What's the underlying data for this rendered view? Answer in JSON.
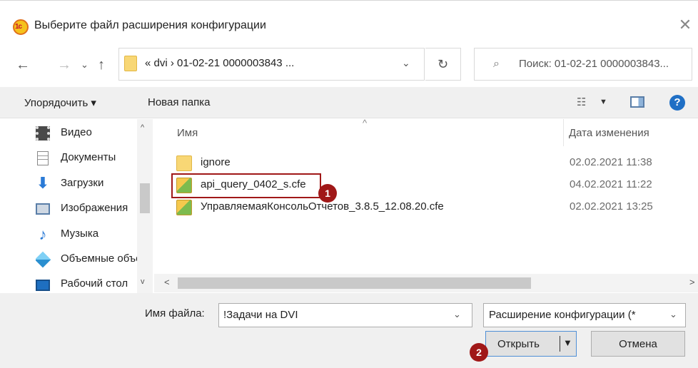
{
  "window": {
    "title": "Выберите файл расширения конфигурации",
    "app_icon_text": "1c",
    "close_glyph": "✕"
  },
  "address_bar": {
    "back_glyph": "←",
    "forward_glyph": "→",
    "recent_glyph": "⌄",
    "up_glyph": "↑",
    "path": "« dvi › 01-02-21 0000003843 ...",
    "dropdown_glyph": "⌄",
    "refresh_glyph": "↻"
  },
  "search": {
    "icon_glyph": "⌕",
    "text": "Поиск: 01-02-21 0000003843..."
  },
  "toolbar": {
    "organize_label": "Упорядочить ▾",
    "new_folder_label": "Новая папка",
    "view_glyph": "☷",
    "view_caret": "▼",
    "help_label": "?"
  },
  "nav_pane": {
    "items": [
      {
        "label": "Видео",
        "icon": "video-icon",
        "color": "#4a4a4a"
      },
      {
        "label": "Документы",
        "icon": "documents-icon",
        "color": "#7a7a7a"
      },
      {
        "label": "Загрузки",
        "icon": "downloads-icon",
        "color": "#2a7ad6"
      },
      {
        "label": "Изображения",
        "icon": "pictures-icon",
        "color": "#5a7ea8"
      },
      {
        "label": "Музыка",
        "icon": "music-icon",
        "color": "#2a7ad6"
      },
      {
        "label": "Объемные объекты",
        "icon": "3d-objects-icon",
        "color": "#3aa0e0"
      },
      {
        "label": "Рабочий стол",
        "icon": "desktop-icon",
        "color": "#1e6fc0"
      }
    ],
    "scroll_up": "^",
    "scroll_down": "v"
  },
  "file_list": {
    "sort_glyph": "^",
    "columns": {
      "name": "Имя",
      "date": "Дата изменения"
    },
    "rows": [
      {
        "name": "ignore",
        "date": "02.02.2021 11:38",
        "type": "folder"
      },
      {
        "name": "api_query_0402_s.cfe",
        "date": "04.02.2021 11:22",
        "type": "cfe"
      },
      {
        "name": "УправляемаяКонсольОтчетов_3.8.5_12.08.20.cfe",
        "date": "02.02.2021 13:25",
        "type": "cfe"
      }
    ]
  },
  "hscroll": {
    "left": "<",
    "right": ">"
  },
  "annotations": {
    "badge_1": "1",
    "badge_2": "2",
    "color": "#a01818"
  },
  "bottom": {
    "filename_label": "Имя файла:",
    "filename_value": "!Задачи на DVI",
    "dropdown_glyph": "⌄",
    "filetype_value": "Расширение конфигурации (*",
    "open_label": "Открыть",
    "open_arrow": "▼",
    "cancel_label": "Отмена"
  }
}
